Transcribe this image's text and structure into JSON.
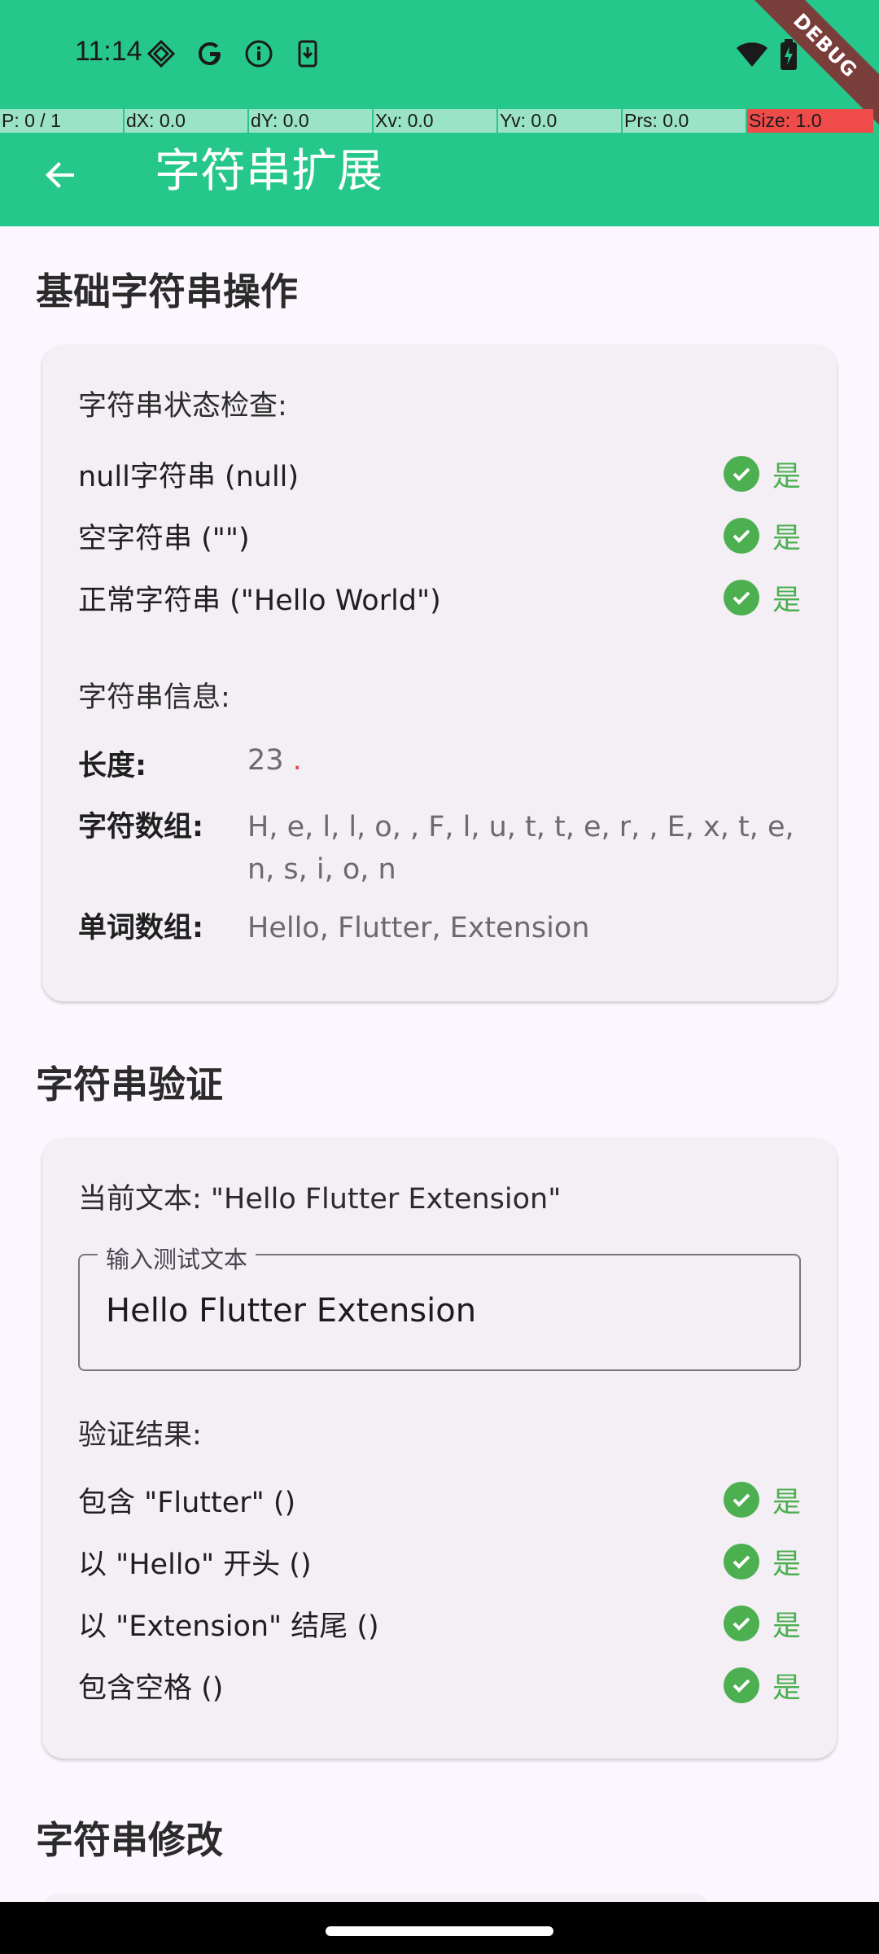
{
  "status_bar": {
    "time": "11:14",
    "left_icons": [
      "vpn-key-icon",
      "google-icon",
      "info-icon",
      "download-icon"
    ],
    "right_icons": [
      "wifi-icon",
      "battery-icon"
    ],
    "debug_label": "DEBUG"
  },
  "perf_overlay": [
    "P: 0 / 1",
    "dX: 0.0",
    "dY: 0.0",
    "Xv: 0.0",
    "Yv: 0.0",
    "Prs: 0.0",
    "Size: 1.0"
  ],
  "app_bar": {
    "title": "字符串扩展",
    "back_icon": "arrow-back-icon"
  },
  "section1": {
    "title": "基础字符串操作",
    "status_label": "字符串状态检查:",
    "checks": [
      {
        "label": "null字符串 (null)",
        "result": "是"
      },
      {
        "label": "空字符串 (\"\")",
        "result": "是"
      },
      {
        "label": "正常字符串 (\"Hello World\")",
        "result": "是"
      }
    ],
    "info_label": "字符串信息:",
    "info": {
      "length_key": "长度:",
      "length_value": "23",
      "chars_key": "字符数组:",
      "chars_value": "H, e, l, l, o,  , F, l, u, t, t, e, r,  , E, x, t, e, n, s, i, o, n",
      "words_key": "单词数组:",
      "words_value": "Hello, Flutter, Extension"
    }
  },
  "section2": {
    "title": "字符串验证",
    "current_text": "当前文本: \"Hello Flutter Extension\"",
    "input_label": "输入测试文本",
    "input_value": "Hello Flutter Extension",
    "results_label": "验证结果:",
    "checks": [
      {
        "label": "包含 \"Flutter\" ()",
        "result": "是"
      },
      {
        "label": "以 \"Hello\" 开头 ()",
        "result": "是"
      },
      {
        "label": "以 \"Extension\" 结尾 ()",
        "result": "是"
      },
      {
        "label": "包含空格 ()",
        "result": "是"
      }
    ]
  },
  "section3": {
    "title": "字符串修改"
  },
  "colors": {
    "app_bar": "#26C78A",
    "success": "#4CAF50",
    "background": "#FCF7FE",
    "card": "#F3EFF5"
  }
}
